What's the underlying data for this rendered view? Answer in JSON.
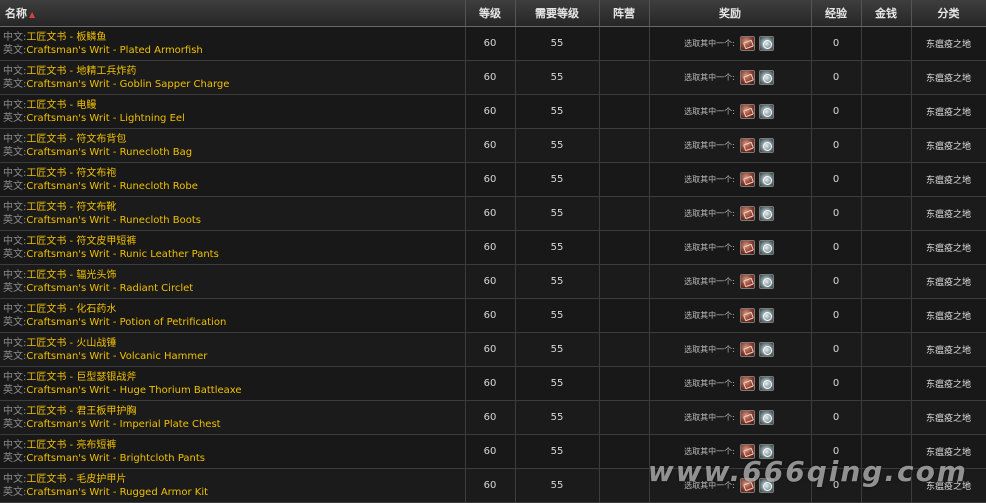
{
  "header": {
    "col_name": "名称",
    "col_level": "等级",
    "col_req_level": "需要等级",
    "col_faction": "阵营",
    "col_reward": "奖励",
    "col_exp": "经验",
    "col_money": "金钱",
    "col_category": "分类",
    "sort_indicator": "▲"
  },
  "labels": {
    "cn_prefix": "中文:",
    "en_prefix": "英文:",
    "reward_choice": "选取其中一个:"
  },
  "colors": {
    "item_link": "#f0c000",
    "label_gray": "#8c8c8c",
    "sort_arrow": "#d84040",
    "background": "#141414"
  },
  "icons": {
    "reward_1": "red-bag-icon",
    "reward_2": "silver-gem-icon"
  },
  "rows": [
    {
      "cn": "工匠文书 - 板鳞鱼",
      "en": "Craftsman's Writ - Plated Armorfish",
      "level": "60",
      "req_level": "55",
      "faction": "",
      "exp": "0",
      "money": "",
      "category": "东瘟疫之地"
    },
    {
      "cn": "工匠文书 - 地精工兵炸药",
      "en": "Craftsman's Writ - Goblin Sapper Charge",
      "level": "60",
      "req_level": "55",
      "faction": "",
      "exp": "0",
      "money": "",
      "category": "东瘟疫之地"
    },
    {
      "cn": "工匠文书 - 电鳗",
      "en": "Craftsman's Writ - Lightning Eel",
      "level": "60",
      "req_level": "55",
      "faction": "",
      "exp": "0",
      "money": "",
      "category": "东瘟疫之地"
    },
    {
      "cn": "工匠文书 - 符文布背包",
      "en": "Craftsman's Writ - Runecloth Bag",
      "level": "60",
      "req_level": "55",
      "faction": "",
      "exp": "0",
      "money": "",
      "category": "东瘟疫之地"
    },
    {
      "cn": "工匠文书 - 符文布袍",
      "en": "Craftsman's Writ - Runecloth Robe",
      "level": "60",
      "req_level": "55",
      "faction": "",
      "exp": "0",
      "money": "",
      "category": "东瘟疫之地"
    },
    {
      "cn": "工匠文书 - 符文布靴",
      "en": "Craftsman's Writ - Runecloth Boots",
      "level": "60",
      "req_level": "55",
      "faction": "",
      "exp": "0",
      "money": "",
      "category": "东瘟疫之地"
    },
    {
      "cn": "工匠文书 - 符文皮甲短裤",
      "en": "Craftsman's Writ - Runic Leather Pants",
      "level": "60",
      "req_level": "55",
      "faction": "",
      "exp": "0",
      "money": "",
      "category": "东瘟疫之地"
    },
    {
      "cn": "工匠文书 - 辐光头饰",
      "en": "Craftsman's Writ - Radiant Circlet",
      "level": "60",
      "req_level": "55",
      "faction": "",
      "exp": "0",
      "money": "",
      "category": "东瘟疫之地"
    },
    {
      "cn": "工匠文书 - 化石药水",
      "en": "Craftsman's Writ - Potion of Petrification",
      "level": "60",
      "req_level": "55",
      "faction": "",
      "exp": "0",
      "money": "",
      "category": "东瘟疫之地"
    },
    {
      "cn": "工匠文书 - 火山战锤",
      "en": "Craftsman's Writ - Volcanic Hammer",
      "level": "60",
      "req_level": "55",
      "faction": "",
      "exp": "0",
      "money": "",
      "category": "东瘟疫之地"
    },
    {
      "cn": "工匠文书 - 巨型瑟银战斧",
      "en": "Craftsman's Writ - Huge Thorium Battleaxe",
      "level": "60",
      "req_level": "55",
      "faction": "",
      "exp": "0",
      "money": "",
      "category": "东瘟疫之地"
    },
    {
      "cn": "工匠文书 - 君王板甲护胸",
      "en": "Craftsman's Writ - Imperial Plate Chest",
      "level": "60",
      "req_level": "55",
      "faction": "",
      "exp": "0",
      "money": "",
      "category": "东瘟疫之地"
    },
    {
      "cn": "工匠文书 - 亮布短裤",
      "en": "Craftsman's Writ - Brightcloth Pants",
      "level": "60",
      "req_level": "55",
      "faction": "",
      "exp": "0",
      "money": "",
      "category": "东瘟疫之地"
    },
    {
      "cn": "工匠文书 - 毛皮护甲片",
      "en": "Craftsman's Writ - Rugged Armor Kit",
      "level": "60",
      "req_level": "55",
      "faction": "",
      "exp": "0",
      "money": "",
      "category": "东瘟疫之地"
    }
  ],
  "watermark": "www.666qing.com"
}
